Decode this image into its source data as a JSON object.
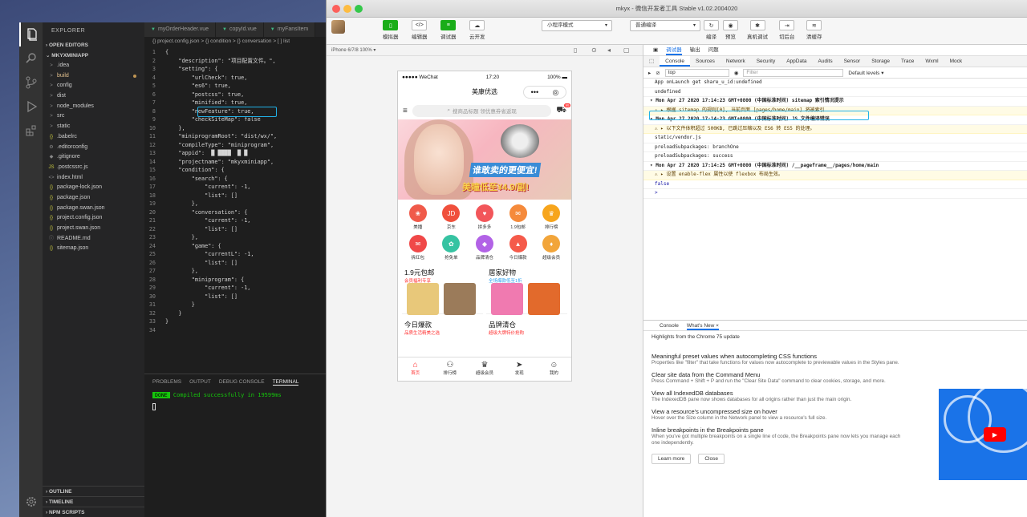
{
  "vscode": {
    "explorer_title": "EXPLORER",
    "open_editors": "OPEN EDITORS",
    "project": "MKYXMINIAPP",
    "files": [
      {
        "label": ".idea",
        "icon": ">",
        "mod": false
      },
      {
        "label": "build",
        "icon": ">",
        "mod": true
      },
      {
        "label": "config",
        "icon": ">",
        "mod": false
      },
      {
        "label": "dist",
        "icon": ">",
        "mod": false
      },
      {
        "label": "node_modules",
        "icon": ">",
        "mod": false
      },
      {
        "label": "src",
        "icon": ">",
        "mod": false
      },
      {
        "label": "static",
        "icon": ">",
        "mod": false
      },
      {
        "label": ".babelrc",
        "icon": "{}",
        "mod": false
      },
      {
        "label": ".editorconfig",
        "icon": "⚙",
        "mod": false
      },
      {
        "label": ".gitignore",
        "icon": "◆",
        "mod": false
      },
      {
        "label": ".postcssrc.js",
        "icon": "JS",
        "mod": false
      },
      {
        "label": "index.html",
        "icon": "<>",
        "mod": false
      },
      {
        "label": "package-lock.json",
        "icon": "{}",
        "mod": false
      },
      {
        "label": "package.json",
        "icon": "{}",
        "mod": false
      },
      {
        "label": "package.swan.json",
        "icon": "{}",
        "mod": false
      },
      {
        "label": "project.config.json",
        "icon": "{}",
        "mod": false
      },
      {
        "label": "project.swan.json",
        "icon": "{}",
        "mod": false
      },
      {
        "label": "README.md",
        "icon": "ⓘ",
        "mod": false
      },
      {
        "label": "sitemap.json",
        "icon": "{}",
        "mod": false
      }
    ],
    "outline": "OUTLINE",
    "timeline": "TIMELINE",
    "npm_scripts": "NPM SCRIPTS",
    "tabs": [
      "myOrderHeader.vue",
      "copyId.vue",
      "myFansItem"
    ],
    "breadcrumb": "{} project.config.json > {} condition > {} conversation > [ ] list",
    "code_lines": [
      "{",
      "    \"description\": \"项目配置文件。\",",
      "    \"setting\": {",
      "        \"urlCheck\": true,",
      "        \"es6\": true,",
      "        \"postcss\": true,",
      "        \"minified\": true,",
      "        \"newFeature\": true,",
      "        \"checkSiteMap\": false",
      "    },",
      "    \"miniprogramRoot\": \"dist/wx/\",",
      "    \"compileType\": \"miniprogram\",",
      "    \"appid\":  █ ████  █ █",
      "    \"projectname\": \"mkyxminiapp\",",
      "    \"condition\": {",
      "        \"search\": {",
      "            \"current\": -1,",
      "            \"list\": []",
      "        },",
      "        \"conversation\": {",
      "            \"current\": -1,",
      "            \"list\": []",
      "        },",
      "        \"game\": {",
      "            \"currentL\": -1,",
      "            \"list\": []",
      "        },",
      "        \"miniprogram\": {",
      "            \"current\": -1,",
      "            \"list\": []",
      "        }",
      "    }",
      "}",
      ""
    ],
    "panel_tabs": [
      "PROBLEMS",
      "OUTPUT",
      "DEBUG CONSOLE",
      "TERMINAL"
    ],
    "active_panel": "TERMINAL",
    "terminal_badge": "DONE",
    "terminal_msg": "Compiled successfully in 19599ms"
  },
  "wechat": {
    "title": "mkyx - 微信开发者工具 Stable v1.02.2004020",
    "toolbar_left": [
      "模拟器",
      "编辑器",
      "调试器",
      "云开发"
    ],
    "mode_select": "小程序模式",
    "compile_select": "普通编译",
    "toolbar_right": [
      "编译",
      "预览",
      "真机调试",
      "切后台",
      "清缓存"
    ],
    "device": "iPhone 6/7/8 100% ▾",
    "phone": {
      "carrier": "●●●●● WeChat",
      "time": "17:20",
      "battery": "100%",
      "nav_title": "美康优选",
      "search_placeholder": "搜商品标题 领优惠券省返现",
      "cart_badge": "99",
      "banner_line1": "谁敢卖的更便宜!",
      "banner_line2": "美瞳低至¥4.9/副!",
      "categories": [
        {
          "label": "美播",
          "color": "#f05a4a",
          "glyph": "❀"
        },
        {
          "label": "京东",
          "color": "#f0503c",
          "glyph": "JD"
        },
        {
          "label": "拼多多",
          "color": "#f2565a",
          "glyph": "♥"
        },
        {
          "label": "1.9包邮",
          "color": "#f58a3b",
          "glyph": "✉"
        },
        {
          "label": "排行榜",
          "color": "#f7a51c",
          "glyph": "♛"
        },
        {
          "label": "拆红包",
          "color": "#f04848",
          "glyph": "✉"
        },
        {
          "label": "抢免单",
          "color": "#36c3a2",
          "glyph": "✿"
        },
        {
          "label": "品牌清仓",
          "color": "#b262e6",
          "glyph": "◆"
        },
        {
          "label": "今日爆款",
          "color": "#f55a4a",
          "glyph": "▲"
        },
        {
          "label": "超级会员",
          "color": "#f2a53a",
          "glyph": "♦"
        }
      ],
      "promo": [
        {
          "title": "1.9元包邮",
          "subtitle": "会员福利专享",
          "subcolor": "#f33"
        },
        {
          "title": "居家好物",
          "subtitle": "全场爆款低至1折",
          "subcolor": "#2ba0f0"
        },
        {
          "title": "今日爆款",
          "subtitle": "品质生活精美之选",
          "subcolor": "#f33"
        },
        {
          "title": "品牌清仓",
          "subtitle": "超级大牌特价抢购",
          "subcolor": "#f33"
        }
      ],
      "tabbar": [
        "首页",
        "排行榜",
        "超级会员",
        "发现",
        "我的"
      ]
    },
    "devtools": {
      "top_tabs": [
        "调试器",
        "输出",
        "问题"
      ],
      "tabs": [
        "Console",
        "Sources",
        "Network",
        "Security",
        "AppData",
        "Audits",
        "Sensor",
        "Storage",
        "Trace",
        "Wxml",
        "Mock"
      ],
      "context": "top",
      "filter_placeholder": "Filter",
      "levels": "Default levels ▾",
      "logs": [
        {
          "text": "App onLaunch get share_u_id:undefined",
          "kind": "plain"
        },
        {
          "text": "undefined",
          "kind": "plain"
        },
        {
          "text": "▾ Mon Apr 27 2020 17:14:23 GMT+0800 (中国标准时间) sitemap 索引情况提示",
          "kind": "hdr"
        },
        {
          "text": "⚠ ▸ 根据 sitemap 的规则[0], 当前页面 [pages/home/main] 将被索引",
          "kind": "warn"
        },
        {
          "text": "▾ Mon Apr 27 2020 17:14:23 GMT+0800 (中国标准时间) JS 文件编译错误",
          "kind": "hdr"
        },
        {
          "text": "⚠ ▸ 以下文件体积超过 500KB, 已跳过压缩以及 ES6 转 ES5 的处理。",
          "kind": "warn"
        },
        {
          "text": "    static/vendor.js",
          "kind": "plain"
        },
        {
          "text": "preloadSubpackages: branchOne",
          "kind": "plain"
        },
        {
          "text": "preloadSubpackages: success",
          "kind": "plain"
        },
        {
          "text": "▾ Mon Apr 27 2020 17:14:25 GMT+0800 (中国标准时间) /__pageframe__/pages/home/main",
          "kind": "hdr"
        },
        {
          "text": "⚠ ▸ 设置 enable-flex 属性以使 flexbox 布局生效。",
          "kind": "warn"
        },
        {
          "text": "false",
          "kind": "val"
        },
        {
          "text": ">",
          "kind": "val"
        }
      ],
      "drawer_tabs": [
        "Console",
        "What's New ×"
      ],
      "whats_new_header": "Highlights from the Chrome 75 update",
      "items": [
        {
          "title": "Meaningful preset values when autocompleting CSS functions",
          "desc": "Properties like \"filter\" that take functions for values now autocomplete to previewable values in the Styles pane."
        },
        {
          "title": "Clear site data from the Command Menu",
          "desc": "Press Command + Shift + P and run the \"Clear Site Data\" command to clear cookies, storage, and more."
        },
        {
          "title": "View all IndexedDB databases",
          "desc": "The IndexedDB pane now shows databases for all origins rather than just the main origin."
        },
        {
          "title": "View a resource's uncompressed size on hover",
          "desc": "Hover over the Size column in the Network panel to view a resource's full size."
        },
        {
          "title": "Inline breakpoints in the Breakpoints pane",
          "desc": "When you've got multiple breakpoints on a single line of code, the Breakpoints pane now lets you manage each one independently."
        }
      ],
      "learn_more": "Learn more",
      "close": "Close"
    }
  }
}
